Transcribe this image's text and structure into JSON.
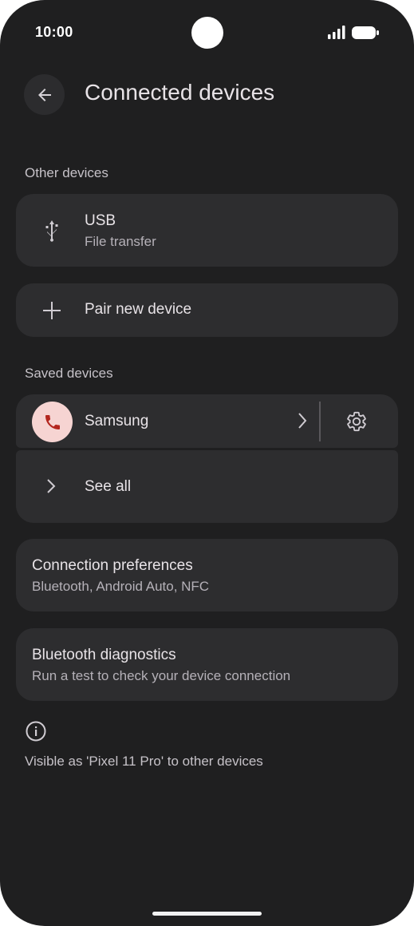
{
  "status_bar": {
    "time": "10:00",
    "icons": [
      "camera-cutout",
      "signal-icon",
      "battery-icon"
    ]
  },
  "header": {
    "back_icon": "arrow-back-icon",
    "title": "Connected devices"
  },
  "other_devices": {
    "label": "Other devices",
    "usb": {
      "icon": "usb-icon",
      "title": "USB",
      "subtitle": "File transfer"
    },
    "pair": {
      "icon": "plus-icon",
      "title": "Pair new device"
    }
  },
  "saved_devices": {
    "label": "Saved devices",
    "device": {
      "icon": "phone-icon",
      "icon_bg": "#f6d4d2",
      "icon_color": "#b3261e",
      "name": "Samsung",
      "chevron_icon": "chevron-right-icon",
      "settings_icon": "gear-icon"
    },
    "see_all": {
      "icon": "chevron-right-icon",
      "label": "See all"
    }
  },
  "connection_preferences": {
    "title": "Connection preferences",
    "subtitle": "Bluetooth, Android Auto, NFC"
  },
  "bluetooth_diagnostics": {
    "title": "Bluetooth diagnostics",
    "subtitle": "Run a test to check your device connection"
  },
  "footer": {
    "info_icon": "info-icon",
    "text": "Visible as 'Pixel 11 Pro' to other devices"
  },
  "colors": {
    "background": "#1f1f20",
    "card": "#2d2d2f",
    "accent_avatar": "#f6d4d2"
  }
}
